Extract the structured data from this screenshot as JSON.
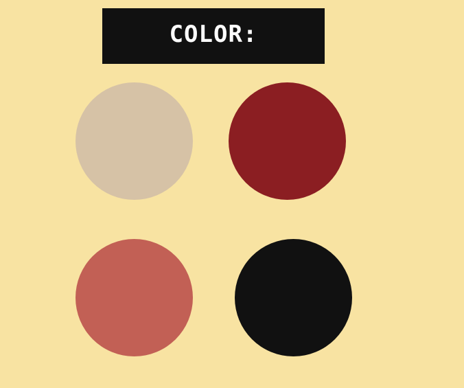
{
  "title": "COLOR:",
  "swatches": [
    {
      "name": "beige",
      "color": "#d6c2a6"
    },
    {
      "name": "dark-red",
      "color": "#8b1e22"
    },
    {
      "name": "coral",
      "color": "#c26055"
    },
    {
      "name": "black",
      "color": "#111111"
    }
  ],
  "background_color": "#f8e3a2",
  "title_bar_color": "#111111"
}
